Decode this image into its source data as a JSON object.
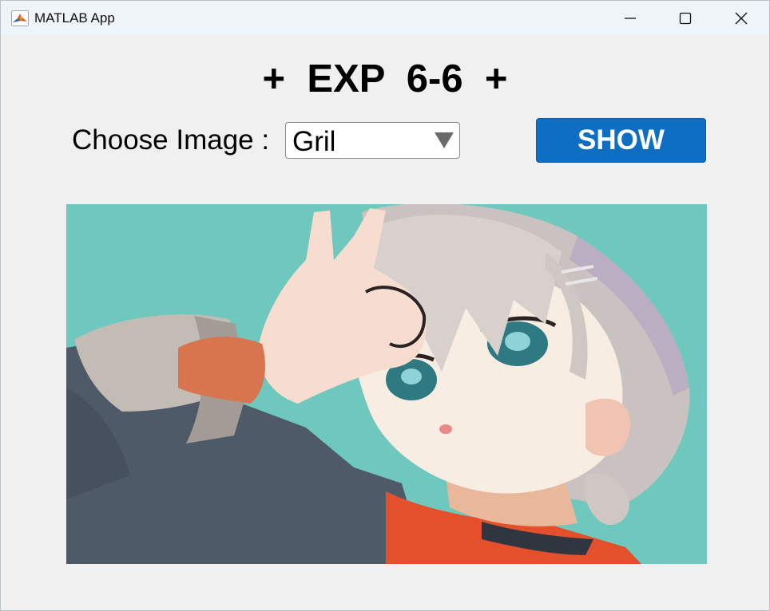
{
  "window": {
    "title": "MATLAB App"
  },
  "main": {
    "heading": "+  EXP  6-6  +",
    "choose_label": "Choose Image :",
    "dropdown_value": "Gril",
    "show_button": "SHOW"
  },
  "colors": {
    "button_bg": "#0e6ec3",
    "window_bg": "#f0f0f0",
    "image_bg": "#6fc8bd"
  },
  "icons": {
    "app": "matlab-logo-icon",
    "minimize": "minimize-icon",
    "maximize": "maximize-icon",
    "close": "close-icon",
    "dropdown": "triangle-down-icon"
  }
}
